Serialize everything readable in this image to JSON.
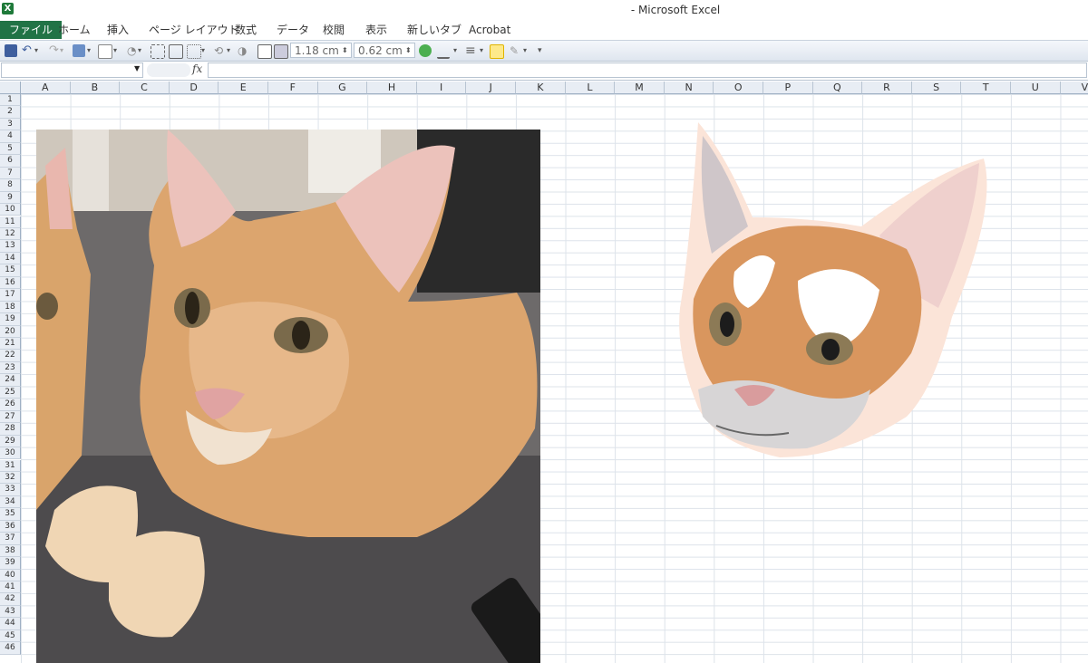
{
  "window": {
    "title": "- Microsoft Excel",
    "app_icon": "excel-icon"
  },
  "ribbon": {
    "tabs": [
      {
        "label": "ファイル",
        "active": true
      },
      {
        "label": "ホーム"
      },
      {
        "label": "挿入"
      },
      {
        "label": "ページ レイアウト"
      },
      {
        "label": "数式"
      },
      {
        "label": "データ"
      },
      {
        "label": "校閲"
      },
      {
        "label": "表示"
      },
      {
        "label": "新しいタブ"
      },
      {
        "label": "Acrobat"
      }
    ]
  },
  "toolbar": {
    "height_value": "1.18 cm",
    "width_value": "0.62 cm"
  },
  "formula_bar": {
    "name_box": "",
    "fx_label": "fx",
    "formula": ""
  },
  "sheet": {
    "columns": [
      "A",
      "B",
      "C",
      "D",
      "E",
      "F",
      "G",
      "H",
      "I",
      "J",
      "K",
      "L",
      "M",
      "N",
      "O",
      "P",
      "Q",
      "R",
      "S",
      "T",
      "U",
      "V"
    ],
    "rows": [
      "1",
      "2",
      "3",
      "4",
      "5",
      "6",
      "7",
      "8",
      "9",
      "10",
      "11",
      "12",
      "13",
      "14",
      "15",
      "16",
      "17",
      "18",
      "19",
      "20",
      "21",
      "22",
      "23",
      "24",
      "25",
      "26",
      "27",
      "28",
      "29",
      "30",
      "31",
      "32",
      "33",
      "34",
      "35",
      "36",
      "37",
      "38",
      "39",
      "40",
      "41",
      "42",
      "43",
      "44",
      "45",
      "46"
    ]
  },
  "colors": {
    "file_tab": "#217346",
    "accent": "#217346"
  }
}
